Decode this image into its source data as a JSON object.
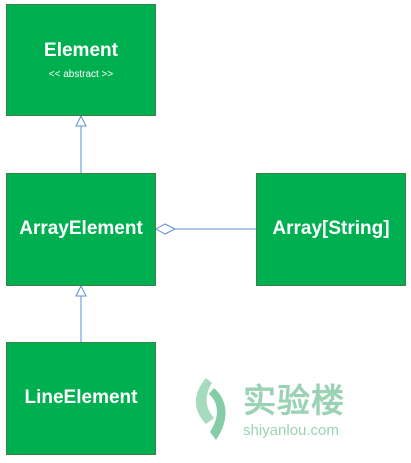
{
  "nodes": {
    "element": {
      "title": "Element",
      "stereotype": "<< abstract >>"
    },
    "array_element": {
      "title": "ArrayElement"
    },
    "array_string": {
      "title": "Array[String]"
    },
    "line_element": {
      "title": "LineElement"
    }
  },
  "relations": [
    {
      "from": "ArrayElement",
      "to": "Element",
      "type": "inheritance"
    },
    {
      "from": "LineElement",
      "to": "ArrayElement",
      "type": "inheritance"
    },
    {
      "from": "ArrayElement",
      "to": "Array[String]",
      "type": "aggregation"
    }
  ],
  "colors": {
    "node_fill": "#00b050",
    "edge": "#5b8fd0",
    "watermark": "#9ad3b4"
  },
  "watermark": {
    "chinese": "实验楼",
    "domain": "shiyanlou.com"
  }
}
